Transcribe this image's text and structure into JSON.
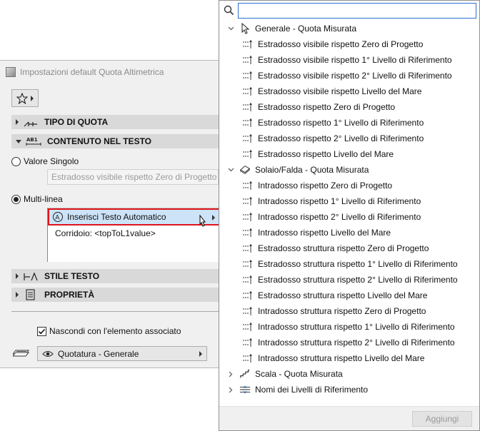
{
  "dialog": {
    "title": "Impostazioni default Quota Altimetrica",
    "sections": {
      "tipo": "TIPO DI QUOTA",
      "contenuto": "CONTENUTO NEL TESTO",
      "stile": "STILE TESTO",
      "proprieta": "PROPRIETÀ"
    },
    "valore_singolo": "Valore Singolo",
    "valore_singolo_field": "Estradosso visibile rispetto Zero di Progetto",
    "multilinea": "Multi-linea",
    "auto_text_button": "Inserisci Testo Automatico",
    "text_content": "Corridoio: <topToL1value>",
    "checkbox_label": "Nascondi con l'elemento associato",
    "layer_value": "Quotatura - Generale"
  },
  "popup": {
    "search": {
      "value": "",
      "placeholder": ""
    },
    "categories": [
      {
        "label": "Generale - Quota Misurata",
        "expanded": true,
        "items": [
          "Estradosso visibile rispetto Zero di Progetto",
          "Estradosso visibile rispetto 1° Livello di Riferimento",
          "Estradosso visibile rispetto 2° Livello di Riferimento",
          "Estradosso visibile rispetto Livello del Mare",
          "Estradosso rispetto Zero di Progetto",
          "Estradosso rispetto 1° Livello di Riferimento",
          "Estradosso rispetto 2° Livello di Riferimento",
          "Estradosso rispetto Livello del Mare"
        ]
      },
      {
        "label": "Solaio/Falda - Quota Misurata",
        "expanded": true,
        "items": [
          "Intradosso rispetto Zero di Progetto",
          "Intradosso rispetto 1° Livello di Riferimento",
          "Intradosso rispetto 2° Livello di Riferimento",
          "Intradosso rispetto Livello del Mare",
          "Estradosso struttura rispetto Zero di Progetto",
          "Estradosso struttura rispetto 1° Livello di Riferimento",
          "Estradosso struttura rispetto 2° Livello di Riferimento",
          "Estradosso struttura rispetto Livello del Mare",
          "Intradosso struttura rispetto Zero di Progetto",
          "Intradosso struttura rispetto 1° Livello di Riferimento",
          "Intradosso struttura rispetto 2° Livello di Riferimento",
          "Intradosso struttura rispetto Livello del Mare"
        ]
      },
      {
        "label": "Scala - Quota Misurata",
        "expanded": false,
        "items": []
      },
      {
        "label": "Nomi dei Livelli di Riferimento",
        "expanded": false,
        "items": []
      }
    ],
    "add_button": "Aggiungi"
  },
  "colors": {
    "selection": "#cde3f7",
    "highlight_border": "#e0141a",
    "search_border": "#2f6fcf",
    "section_bg": "#d9d9d9"
  },
  "icons": {
    "app": "app-icon",
    "favorites": "star-icon",
    "category_generale": "cursor-arrow-icon",
    "category_solaio": "slab-icon",
    "category_scala": "stair-icon",
    "category_livelli": "levels-icon",
    "item": "elevation-dimension-icon"
  }
}
